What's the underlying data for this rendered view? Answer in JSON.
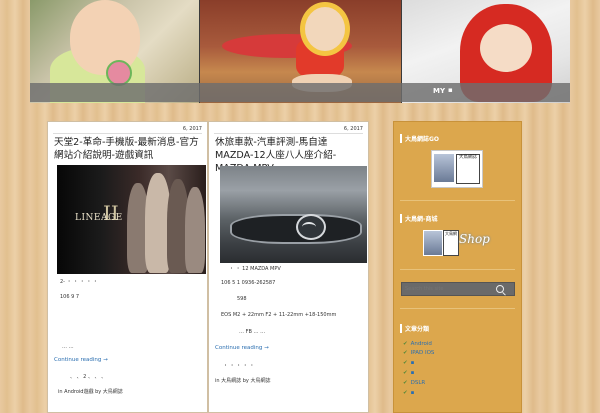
{
  "header": {
    "nav_items": [
      "MY",
      "▪"
    ]
  },
  "posts": [
    {
      "date": "6, 2017",
      "title": "天堂2-革命-手機版-最新消息-官方網站介紹說明-遊戲資訊",
      "thumb_logo": "LINEAGE",
      "thumb_logo_numeral": "II",
      "excerpt": [
        "2-   ・   ・   ・   ・   ・",
        "106 9 7",
        "…  …",
        "、  、  2  、  、  、"
      ],
      "read_more": "Continue reading →",
      "footer": "in Android遊戲 by 大鳥網誌"
    },
    {
      "date": "6, 2017",
      "title": "休旅車款-汽車評測-馬自達MAZDA-12人座八人座介紹-MAZDA MPV",
      "excerpt": [
        "・   ・   12   MAZDA MPV",
        "106 5 1      0936-262587",
        "598",
        "EOS M2 + 22mm F2 + 11-22mm +18-150mm",
        "…   FB   …   …"
      ],
      "read_more": "Continue reading →",
      "dots": "・  ・  ・  ・  ・",
      "footer": "in 大鳥網誌 by 大鳥網誌"
    }
  ],
  "sidebar": {
    "widget1_title": "大鳥網誌GO",
    "widget1_badge": "大鳥網誌",
    "widget2_title": "大鳥網-商城",
    "widget2_badge": "大鳥網",
    "widget2_shop": "Shop",
    "search_placeholder": "Search this site",
    "categories_title": "文章分類",
    "categories": [
      "Android",
      "IPAD IOS",
      "▪",
      "▪",
      "DSLR",
      "▪"
    ]
  }
}
